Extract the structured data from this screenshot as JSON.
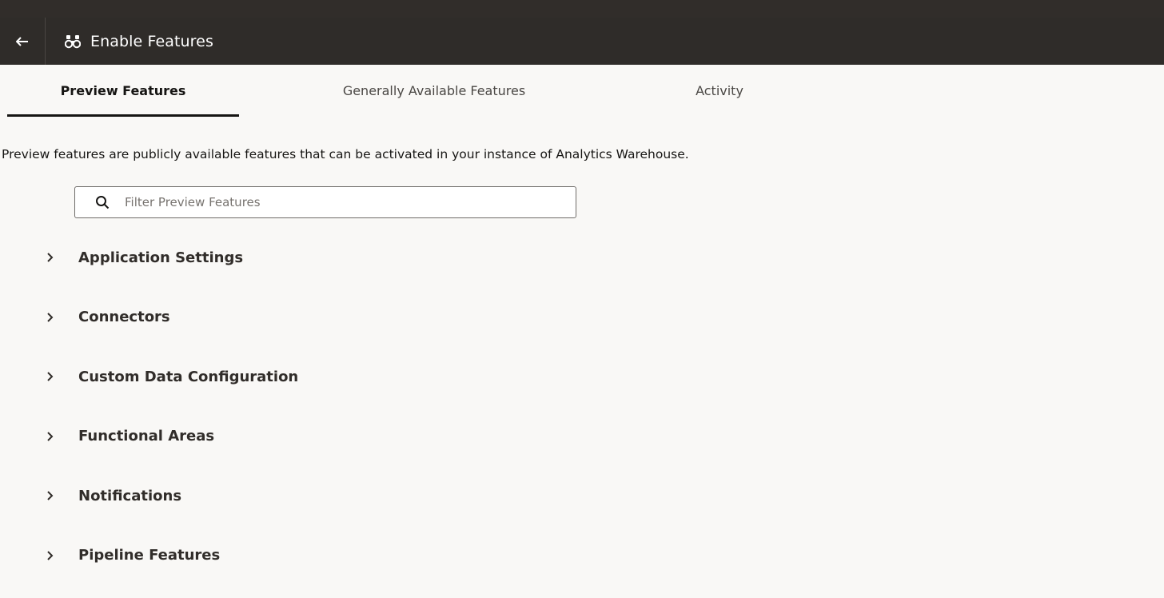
{
  "header": {
    "title": "Enable Features",
    "back_icon": "arrow-left-icon",
    "title_icon": "binoculars-icon"
  },
  "tabs": [
    {
      "label": "Preview Features",
      "active": true
    },
    {
      "label": "Generally Available Features",
      "active": false
    },
    {
      "label": "Activity",
      "active": false
    }
  ],
  "description": "Preview features are publicly available features that can be activated in your instance of Analytics Warehouse.",
  "search": {
    "placeholder": "Filter Preview Features",
    "value": "",
    "icon": "search-icon"
  },
  "groups": [
    {
      "label": "Application Settings",
      "expanded": false
    },
    {
      "label": "Connectors",
      "expanded": false
    },
    {
      "label": "Custom Data Configuration",
      "expanded": false
    },
    {
      "label": "Functional Areas",
      "expanded": false
    },
    {
      "label": "Notifications",
      "expanded": false
    },
    {
      "label": "Pipeline Features",
      "expanded": false
    }
  ],
  "colors": {
    "header_bg": "#2f2c29",
    "page_bg": "#f9f8f6",
    "text": "#161513"
  }
}
